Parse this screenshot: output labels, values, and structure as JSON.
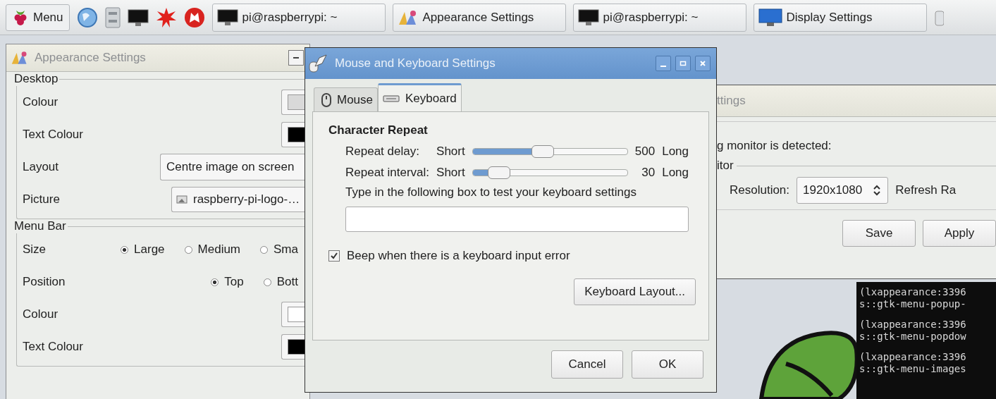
{
  "taskbar": {
    "menu_label": "Menu",
    "tasks": [
      {
        "label": "pi@raspberrypi: ~",
        "kind": "terminal"
      },
      {
        "label": "Appearance Settings",
        "kind": "appearance"
      },
      {
        "label": "pi@raspberrypi: ~",
        "kind": "terminal"
      },
      {
        "label": "Display Settings",
        "kind": "display"
      }
    ]
  },
  "appearance_window": {
    "title": "Appearance Settings",
    "desktop": {
      "legend": "Desktop",
      "rows": [
        {
          "kind": "color",
          "label": "Colour",
          "color": "#d9d9d9"
        },
        {
          "kind": "color",
          "label": "Text Colour",
          "color": "#000000"
        },
        {
          "kind": "combo",
          "label": "Layout",
          "value": "Centre image on screen"
        },
        {
          "kind": "file",
          "label": "Picture",
          "value": "raspberry-pi-logo-…"
        }
      ]
    },
    "menu_bar": {
      "legend": "Menu Bar",
      "rows": [
        {
          "kind": "radio",
          "label": "Size",
          "options": [
            {
              "label": "Large",
              "selected": true
            },
            {
              "label": "Medium",
              "selected": false
            },
            {
              "label": "Sma",
              "selected": false
            }
          ]
        },
        {
          "kind": "radio",
          "label": "Position",
          "options": [
            {
              "label": "Top",
              "selected": true
            },
            {
              "label": "Bott",
              "selected": false
            }
          ]
        },
        {
          "kind": "color",
          "label": "Colour",
          "color": "#ffffff"
        },
        {
          "kind": "color",
          "label": "Text Colour",
          "color": "#000000"
        }
      ]
    }
  },
  "display_window": {
    "title": "ttings",
    "detected_text": "g monitor is detected:",
    "legend": "itor",
    "resolution_label": "Resolution:",
    "resolution_value": "1920x1080",
    "refresh_label": "Refresh Ra",
    "buttons": [
      "Save",
      "Apply"
    ]
  },
  "terminal": {
    "messages": [
      {
        "lines": [
          "(lxappearance:3396",
          "s::gtk-menu-popup-"
        ]
      },
      {
        "lines": [
          "(lxappearance:3396",
          "s::gtk-menu-popdow"
        ]
      },
      {
        "lines": [
          "(lxappearance:3396",
          "s::gtk-menu-images"
        ]
      }
    ]
  },
  "dialog": {
    "title": "Mouse and Keyboard Settings",
    "tabs": [
      {
        "label": "Mouse",
        "kind": "mouse",
        "selected": false
      },
      {
        "label": "Keyboard",
        "kind": "keyboard",
        "selected": true
      }
    ],
    "heading": "Character Repeat",
    "sliders": [
      {
        "label": "Repeat delay:",
        "min_label": "Short",
        "level": 0.38,
        "reading": "500",
        "max_label": "Long"
      },
      {
        "label": "Repeat interval:",
        "min_label": "Short",
        "level": 0.1,
        "reading": "30",
        "max_label": "Long"
      }
    ],
    "test_label": "Type in the following box to test your keyboard settings",
    "beep": {
      "label": "Beep when there is a keyboard input error",
      "checked": true
    },
    "layout_button": "Keyboard Layout...",
    "buttons": [
      "Cancel",
      "OK"
    ]
  }
}
